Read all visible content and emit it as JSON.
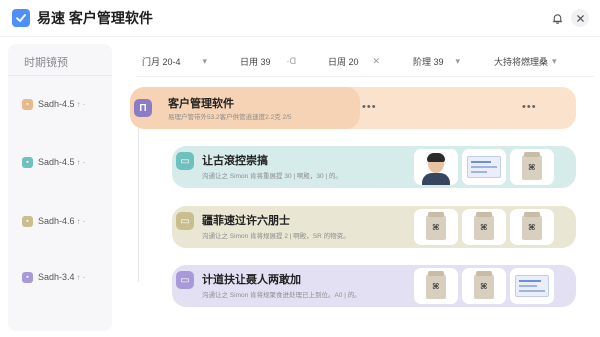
{
  "app": {
    "title": "易速 客户管理软件",
    "accent": "#4f8ff7"
  },
  "sidebar": {
    "title": "时期镜预",
    "items": [
      {
        "label": "Sadh-4.5",
        "tick": "↑ ·",
        "color": "#e8b98a"
      },
      {
        "label": "Sadh-4.5",
        "tick": "↑ ·",
        "color": "#6fc1bd"
      },
      {
        "label": "Sadh-4.6",
        "tick": "↑ ·",
        "color": "#c8be8e"
      },
      {
        "label": "Sadh-3.4",
        "tick": "↑ ·",
        "color": "#a89ad8"
      }
    ]
  },
  "filters": [
    {
      "label": "门月 20-4",
      "glyph": "▾"
    },
    {
      "label": "日用 39",
      "glyph": "·Ɑ"
    },
    {
      "label": "日周 20",
      "glyph": "✕"
    },
    {
      "label": "阶理 39",
      "glyph": "▾"
    },
    {
      "label": "大持将燃理桑",
      "glyph": "▾"
    }
  ],
  "cards": [
    {
      "title": "客户管理软件",
      "subtitle": "易理户管带外53.2客户供管逍速度2.2克 2/5",
      "badge": "Π",
      "more": "•••",
      "more2": "•••",
      "bg": "#fae2cd",
      "badge_color": "#8c7bc5"
    },
    {
      "title": "让古滾控崇搞",
      "subtitle": "沟通让之 Simon 肯将重展提 30 | 啊殿，30 | 的。",
      "badge": "▭",
      "bg": "#d5ecea",
      "badge_color": "#6fc1bd"
    },
    {
      "title": "疆菲速过许六朋士",
      "subtitle": "沟通让之 Simon 肯将规展提 2 | 啊殿，SR 的物资。",
      "badge": "▭",
      "bg": "#e9e6d3",
      "badge_color": "#c8be8e"
    },
    {
      "title": "计道扶让聂人两敢加",
      "subtitle": "沟通让之 Simon 肯将规聚食进处理已上到位。A0 | 的。",
      "badge": "▭",
      "bg": "#e4e0f3",
      "badge_color": "#a89ad8"
    }
  ]
}
